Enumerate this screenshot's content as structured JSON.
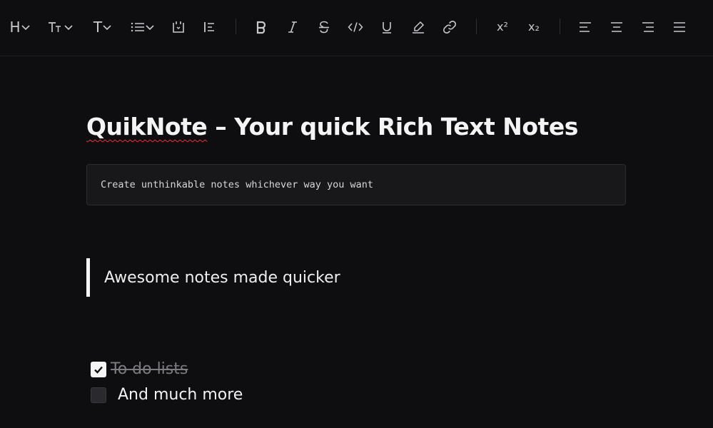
{
  "toolbar": {
    "heading_label": "H",
    "font_size_label": "TT",
    "text_style_label": "T",
    "superscript_label": "x²",
    "subscript_label": "x₂"
  },
  "document": {
    "title_prefix": "QuikNote",
    "title_rest": " – Your quick Rich Text Notes",
    "code_text": "Create unthinkable notes whichever way you want",
    "quote_text": "Awesome notes made quicker",
    "tasks": [
      {
        "label": "To do lists",
        "checked": true
      },
      {
        "label": "And much more",
        "checked": false
      }
    ]
  }
}
